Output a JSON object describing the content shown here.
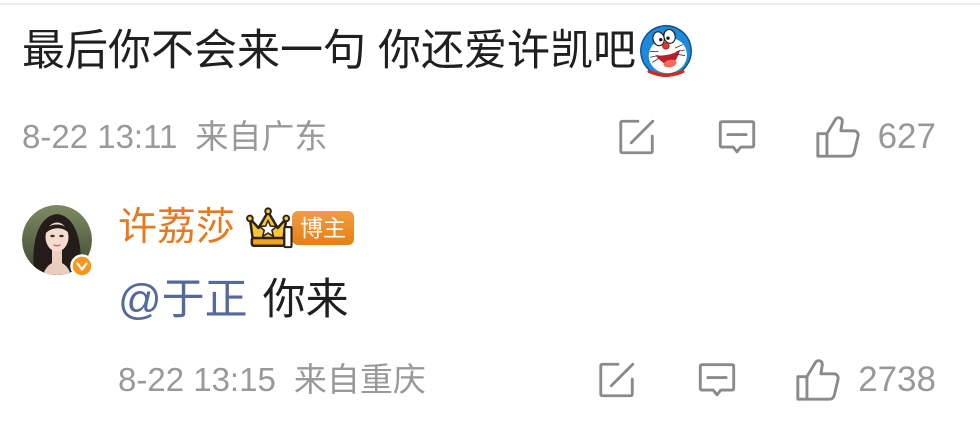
{
  "colors": {
    "background": "#ffffff",
    "text": "#1f1f1f",
    "meta": "#999999",
    "icon": "#8a8a8a",
    "author": "#e8791d",
    "mention": "#546a9b",
    "badge": "#ef8417",
    "divider": "#ededed"
  },
  "icons": {
    "emoji": "doraemon-emoji-icon",
    "repost": "repost-icon",
    "comment": "comment-icon",
    "like": "like-icon",
    "verified": "verified-badge-icon",
    "fan_crown": "crown-icon"
  },
  "comments": [
    {
      "text": "最后你不会来一句 你还爱许凯吧",
      "date": "8-22 13:11",
      "location": "来自广东",
      "like_count": "627"
    },
    {
      "author": "许荔莎",
      "author_badge": "博主",
      "mention": "@于正",
      "text": "你来",
      "date": "8-22 13:15",
      "location": "来自重庆",
      "like_count": "2738"
    }
  ]
}
